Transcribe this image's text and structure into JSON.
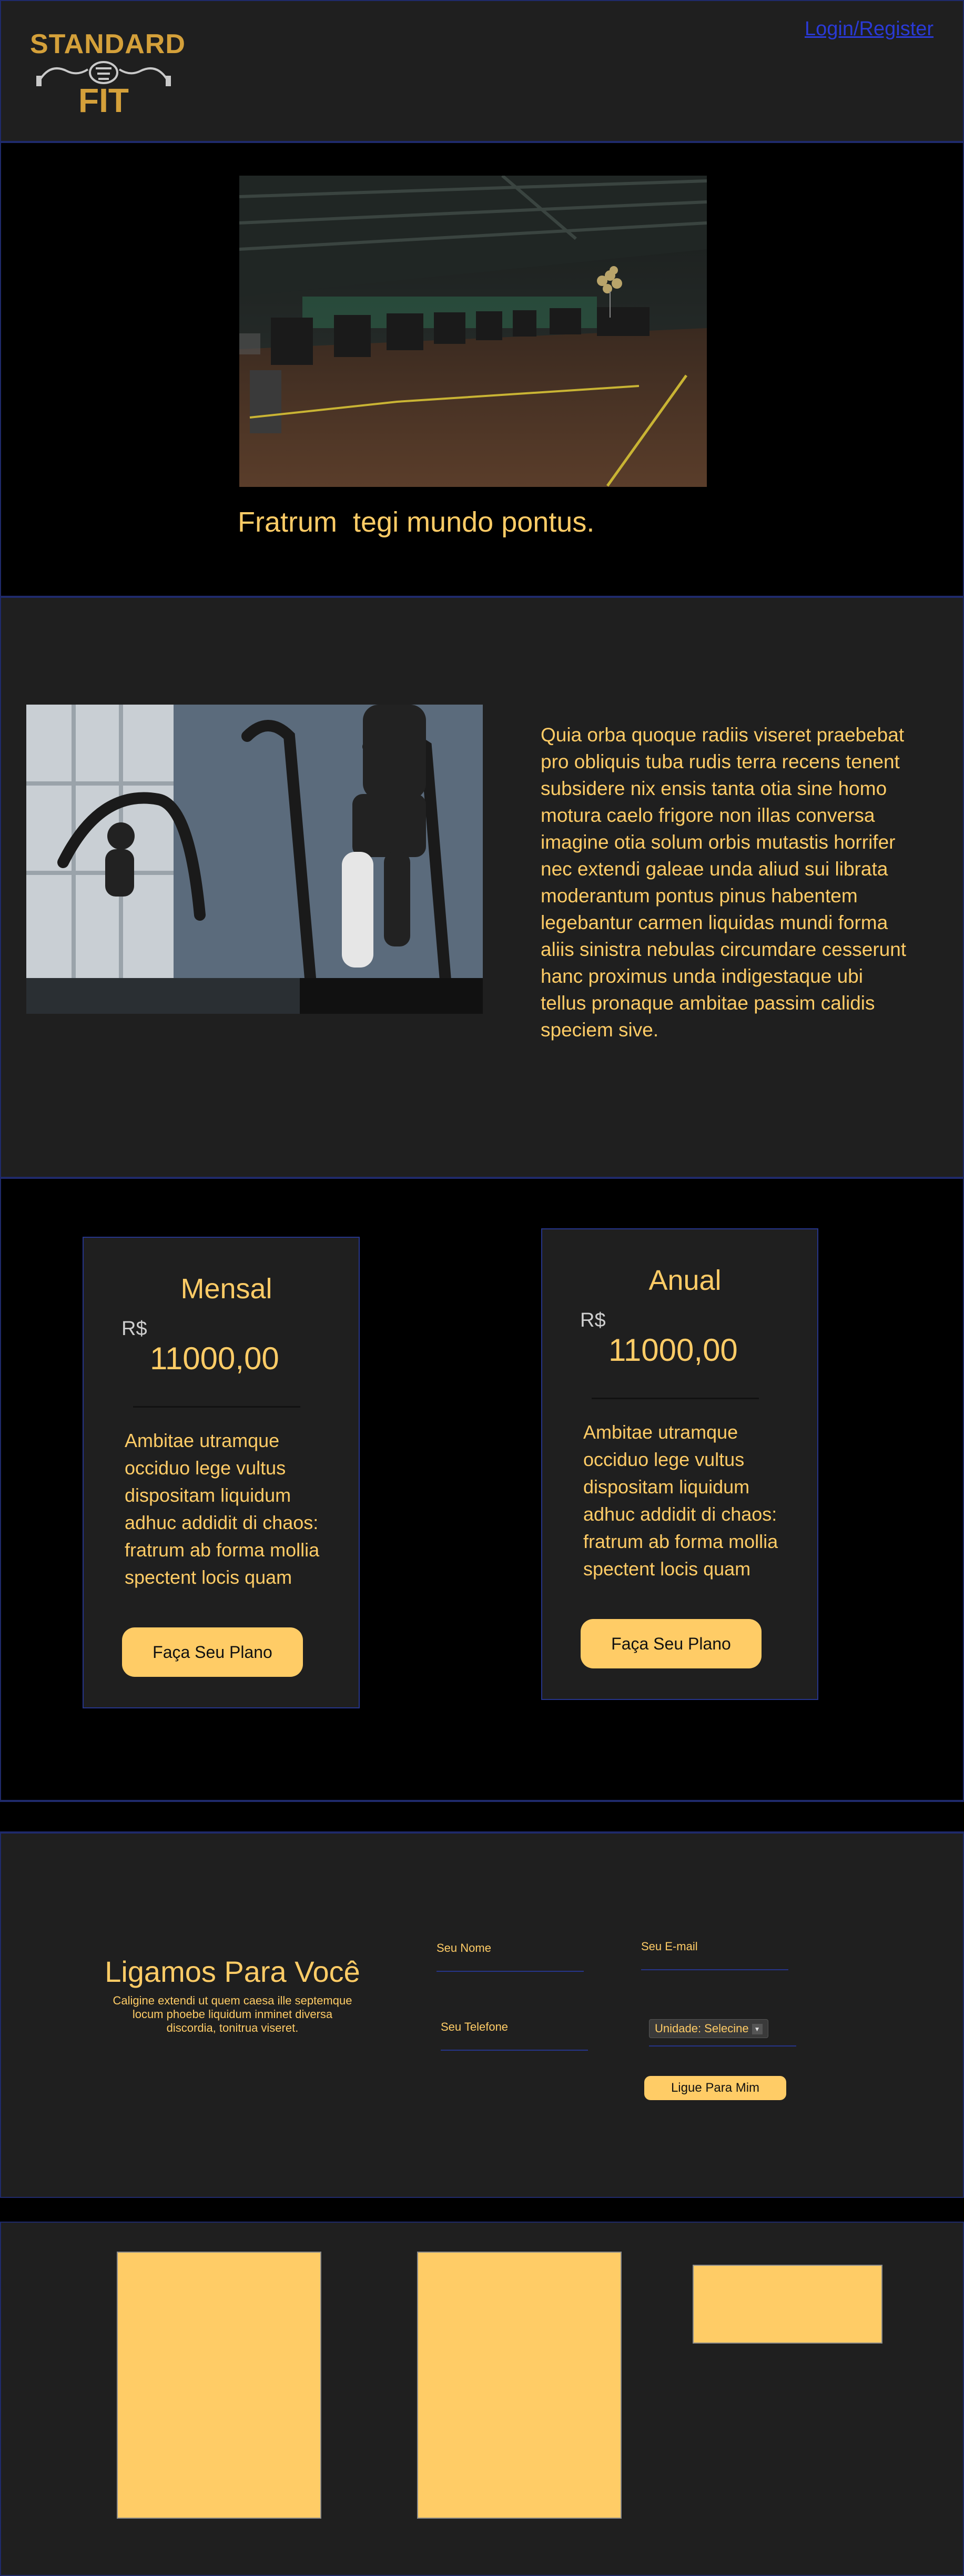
{
  "header": {
    "logo": {
      "line1": "STANDARD",
      "line2": "FIT"
    },
    "login_link": "Login/Register"
  },
  "hero": {
    "title": "Fratrum  tegi mundo pontus."
  },
  "about": {
    "text": "Quia orba quoque radiis viseret praebebat pro obliquis tuba rudis terra recens tenent subsidere nix ensis tanta otia sine homo motura caelo frigore non illas conversa imagine otia solum orbis mutastis horrifer nec extendi galeae unda aliud sui librata moderantum pontus pinus habentem legebantur carmen liquidas mundi forma aliis sinistra nebulas circumdare cesserunt hanc proximus unda indigestaque ubi tellus pronaque ambitae passim calidis speciem sive."
  },
  "plans": [
    {
      "name": "Mensal",
      "currency": "R$",
      "price": "11000,00",
      "description": "Ambitae utramque occiduo lege vultus dispositam liquidum adhuc addidit di chaos: fratrum ab forma mollia spectent locis quam",
      "button": "Faça Seu Plano"
    },
    {
      "name": "Anual",
      "currency": "R$",
      "price": "11000,00",
      "description": "Ambitae utramque occiduo lege vultus dispositam liquidum adhuc addidit di chaos: fratrum ab forma mollia spectent locis quam",
      "button": "Faça Seu Plano"
    }
  ],
  "contact": {
    "title": "Ligamos Para Você",
    "subtitle": "Caligine extendi ut quem caesa ille septemque locum phoebe liquidum inminet diversa discordia, tonitrua viseret.",
    "fields": {
      "name_label": "Seu Nome",
      "email_label": "Seu E-mail",
      "phone_label": "Seu Telefone",
      "unit_select": "Unidade: Selecine"
    },
    "button": "Ligue Para Mim"
  },
  "colors": {
    "accent": "#ffcc66",
    "panel": "#1f1f1f",
    "background": "#000000",
    "border": "#26358a",
    "link": "#2a3ad6",
    "logo": "#d4a03a"
  }
}
